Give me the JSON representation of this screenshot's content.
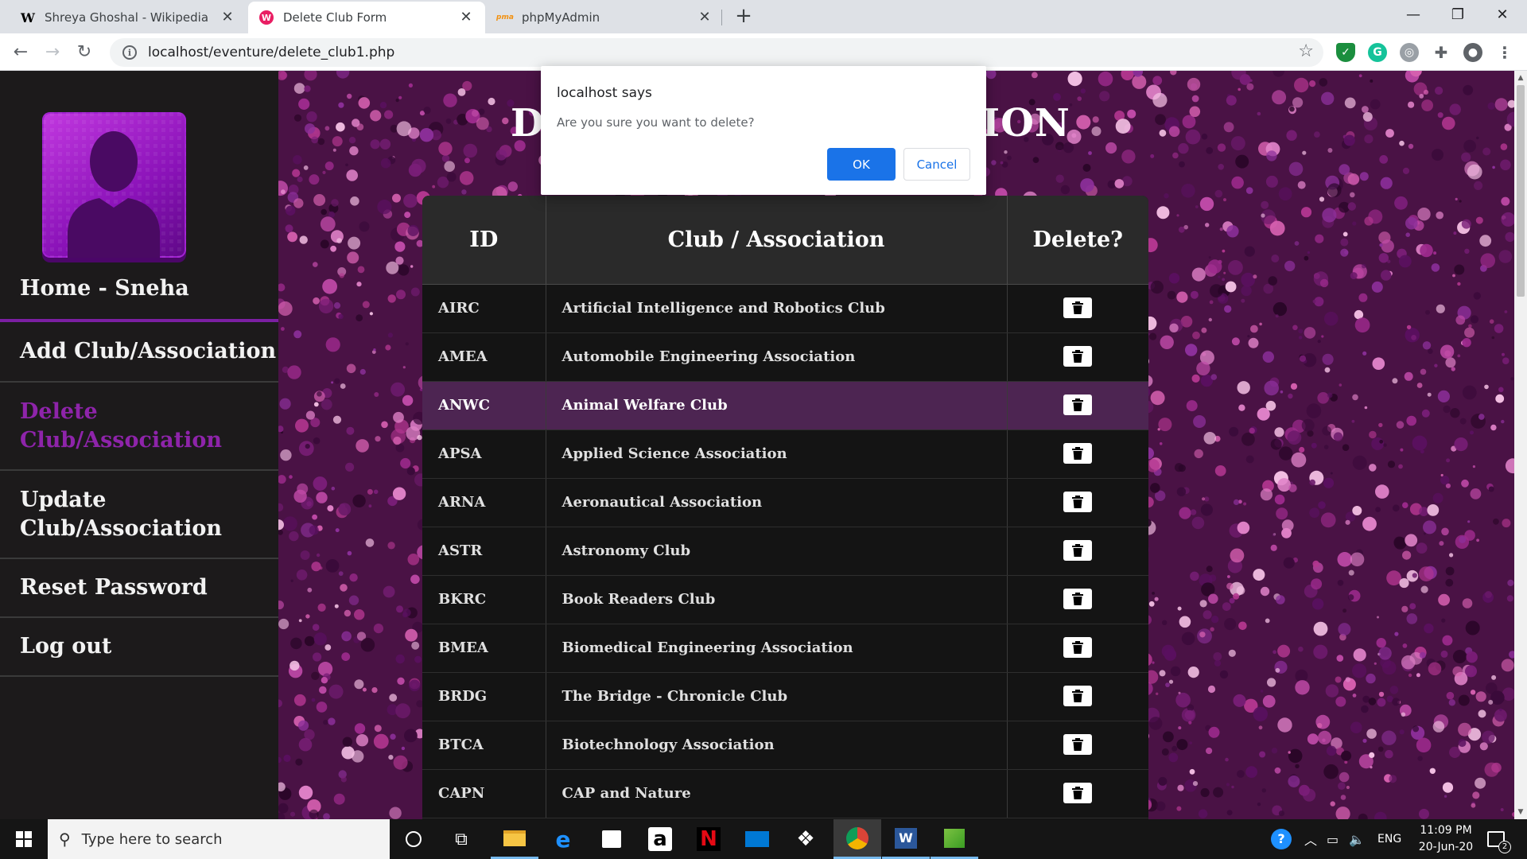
{
  "browser": {
    "tabs": [
      {
        "title": "Shreya Ghoshal - Wikipedia",
        "favicon": "W"
      },
      {
        "title": "Delete Club Form",
        "favicon": "W"
      },
      {
        "title": "phpMyAdmin",
        "favicon": "pma"
      }
    ],
    "url": "localhost/eventure/delete_club1.php"
  },
  "sidebar": {
    "items": [
      {
        "label": "Home - Sneha"
      },
      {
        "label": "Add Club/Association"
      },
      {
        "label": "Delete Club/Association"
      },
      {
        "label": "Update Club/Association"
      },
      {
        "label": "Reset Password"
      },
      {
        "label": "Log out"
      }
    ]
  },
  "page": {
    "heading_left": "D",
    "heading_right": "ION"
  },
  "table": {
    "headers": [
      "ID",
      "Club / Association",
      "Delete?"
    ],
    "rows": [
      {
        "id": "AIRC",
        "name": "Artificial Intelligence and Robotics Club"
      },
      {
        "id": "AMEA",
        "name": "Automobile Engineering Association"
      },
      {
        "id": "ANWC",
        "name": "Animal Welfare Club"
      },
      {
        "id": "APSA",
        "name": "Applied Science Association"
      },
      {
        "id": "ARNA",
        "name": "Aeronautical Association"
      },
      {
        "id": "ASTR",
        "name": "Astronomy Club"
      },
      {
        "id": "BKRC",
        "name": "Book Readers Club"
      },
      {
        "id": "BMEA",
        "name": "Biomedical Engineering Association"
      },
      {
        "id": "BRDG",
        "name": "The Bridge - Chronicle Club"
      },
      {
        "id": "BTCA",
        "name": "Biotechnology Association"
      },
      {
        "id": "CAPN",
        "name": "CAP and Nature"
      }
    ]
  },
  "dialog": {
    "title": "localhost says",
    "message": "Are you sure you want to delete?",
    "ok": "OK",
    "cancel": "Cancel"
  },
  "taskbar": {
    "search_placeholder": "Type here to search",
    "lang": "ENG",
    "time": "11:09 PM",
    "date": "20-Jun-20",
    "notifications": "2"
  },
  "colors": {
    "accent": "#7b1fa2",
    "active_link": "#8e24aa",
    "highlight_row": "#4d2552",
    "dialog_button": "#1a73e8"
  }
}
